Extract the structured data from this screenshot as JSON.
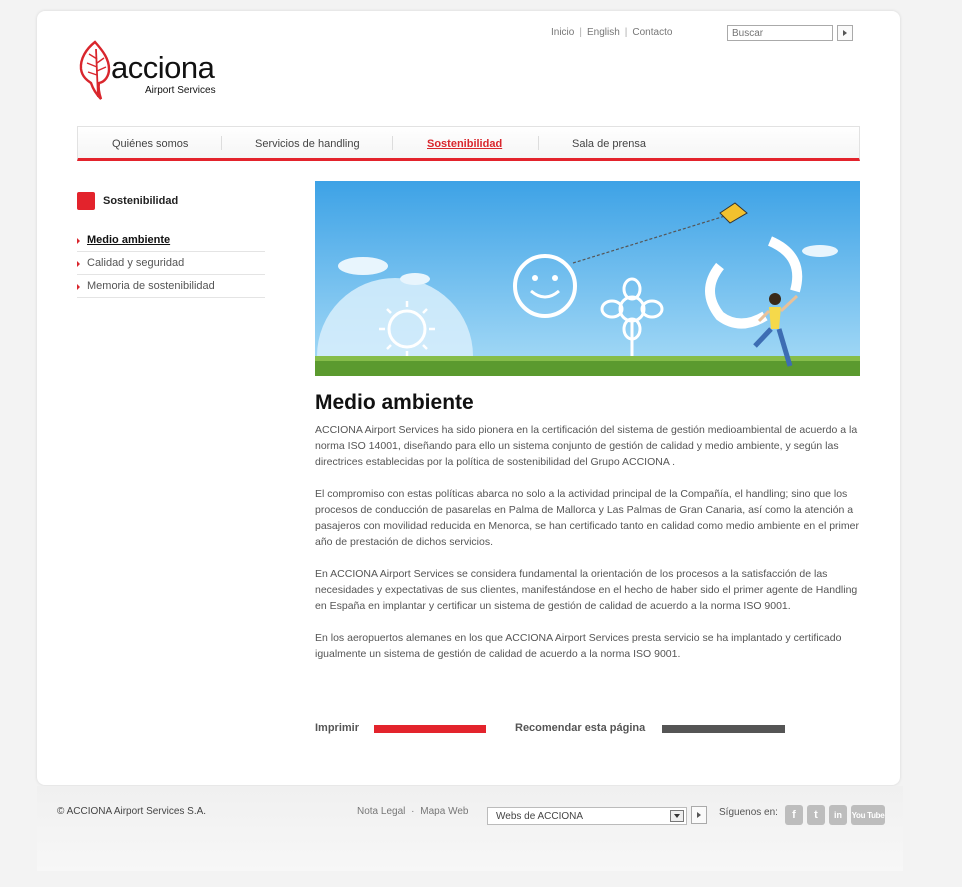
{
  "header": {
    "links": [
      "Inicio",
      "English",
      "Contacto"
    ],
    "search_placeholder": "Buscar"
  },
  "logo": {
    "name": "acciona",
    "sub": "Airport Services"
  },
  "nav": {
    "items": [
      "Quiénes somos",
      "Servicios de handling",
      "Sostenibilidad",
      "Sala de prensa"
    ],
    "active": "Sostenibilidad"
  },
  "sidebar": {
    "title": "Sostenibilidad",
    "items": [
      "Medio ambiente",
      "Calidad y seguridad",
      "Memoria de sostenibilidad"
    ],
    "active": "Medio ambiente"
  },
  "content": {
    "title": "Medio ambiente",
    "paragraphs": [
      "ACCIONA Airport Services ha sido pionera en la certificación del sistema de gestión medioambiental de acuerdo a la norma ISO 14001, diseñando para ello un sistema conjunto de gestión de calidad y medio ambiente, y según las directrices establecidas por la política de sostenibilidad del Grupo ACCIONA .",
      "El compromiso con estas políticas abarca no solo a la actividad principal de la Compañía, el handling; sino que los procesos de conducción de pasarelas en Palma de Mallorca y Las Palmas de Gran Canaria, así como la atención a pasajeros con movilidad reducida en Menorca, se han certificado tanto en calidad como medio ambiente en el primer año de prestación de dichos servicios.",
      "En ACCIONA Airport Services se considera fundamental la orientación de los procesos a la satisfacción de las necesidades y expectativas de sus clientes, manifestándose en el hecho de haber sido el primer agente de Handling en España en implantar y certificar un sistema de gestión de calidad de acuerdo a la norma ISO 9001.",
      "En los aeropuertos alemanes en los que ACCIONA Airport Services presta servicio se ha implantado y certificado igualmente un sistema de gestión de calidad de acuerdo a la norma ISO 9001."
    ],
    "print_label": "Imprimir",
    "recommend_label": "Recomendar esta página"
  },
  "footer": {
    "copyright": "© ACCIONA Airport Services S.A.",
    "legal": "Nota Legal",
    "map": "Mapa Web",
    "select_value": "Webs de ACCIONA",
    "follow_label": "Síguenos en:",
    "social": [
      "f",
      "t",
      "in",
      "You Tube"
    ]
  },
  "colors": {
    "accent": "#e3232c",
    "dark_bar": "#555555"
  }
}
